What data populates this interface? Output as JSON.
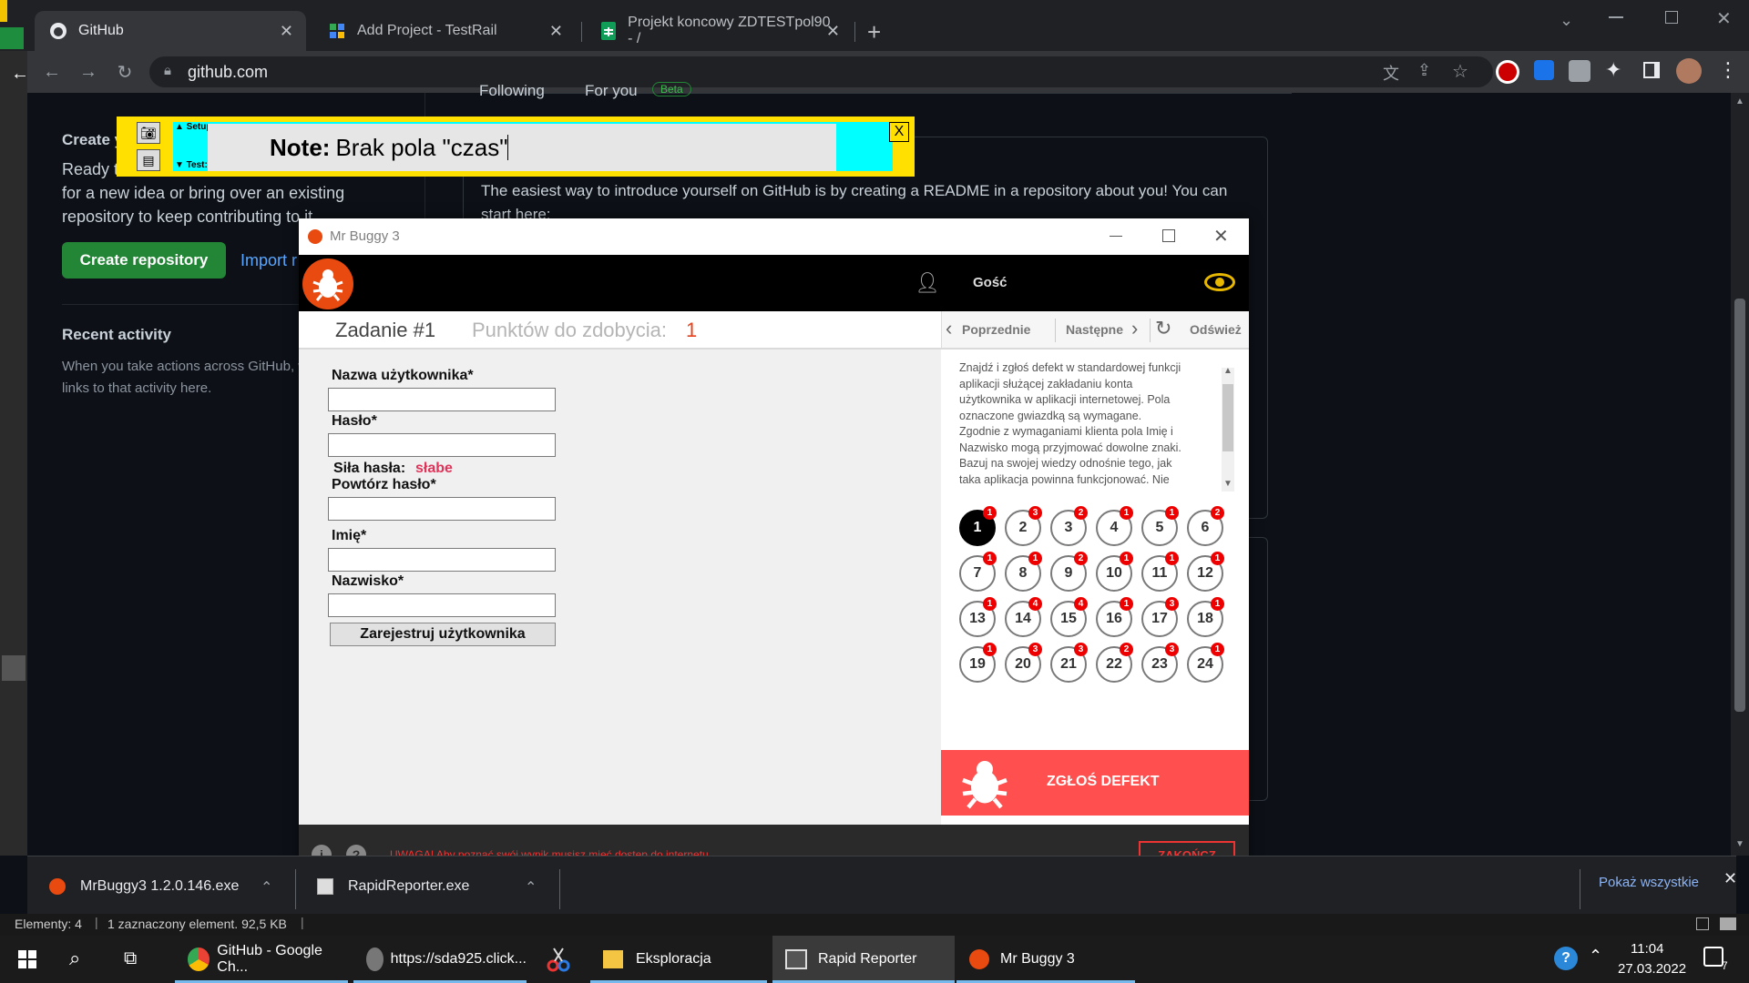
{
  "browser": {
    "tabs": [
      {
        "label": "GitHub"
      },
      {
        "label": "Add Project - TestRail"
      },
      {
        "label": "Projekt koncowy ZDTESTpol90 - /"
      }
    ],
    "url": "github.com"
  },
  "github": {
    "feed_tabs": [
      "Following",
      "For you",
      "Beta"
    ],
    "create_heading": "Create y",
    "create_text_1": "Ready t",
    "create_text_2": "for a new idea or bring over an existing",
    "create_text_3": "repository to keep contributing to it.",
    "create_button": "Create repository",
    "import_link": "Import r",
    "recent_heading": "Recent activity",
    "recent_text_1": "When you take actions across GitHub, w",
    "recent_text_2": "links to that activity here.",
    "readme_text_1": "The easiest way to introduce yourself on GitHub is by creating a README in a repository about you! You can",
    "readme_text_2": "start here:"
  },
  "rapid_reporter": {
    "setup_label": "▲ Setup:",
    "test_label": "▼ Test:",
    "note_label": "Note:",
    "note_text": "Brak pola \"czas\"",
    "close_label": "X"
  },
  "mrbuggy": {
    "window_title": "Mr Buggy 3",
    "user_label": "Gość",
    "task_title": "Zadanie #1",
    "points_label": "Punktów do zdobycia:",
    "points_value": "1",
    "nav_prev": "Poprzednie",
    "nav_next": "Następne",
    "nav_refresh": "Odśwież",
    "form": {
      "username_label": "Nazwa użytkownika*",
      "password_label": "Hasło*",
      "strength_label": "Siła hasła:",
      "strength_value": "słabe",
      "repeat_label": "Powtórz hasło*",
      "firstname_label": "Imię*",
      "lastname_label": "Nazwisko*",
      "submit_label": "Zarejestruj użytkownika"
    },
    "description_lines": [
      "Znajdź i zgłoś defekt w standardowej funkcji",
      "aplikacji służącej zakładaniu konta",
      "użytkownika w aplikacji internetowej. Pola",
      "oznaczone gwiazdką są wymagane.",
      "Zgodnie z wymaganiami klienta pola Imię i",
      "Nazwisko mogą przyjmować dowolne znaki.",
      "Bazuj na swojej wiedzy odnośnie tego, jak",
      "taka aplikacja powinna funkcjonować. Nie"
    ],
    "tasks": [
      {
        "n": "1",
        "badge": "1"
      },
      {
        "n": "2",
        "badge": "3"
      },
      {
        "n": "3",
        "badge": "2"
      },
      {
        "n": "4",
        "badge": "1"
      },
      {
        "n": "5",
        "badge": "1"
      },
      {
        "n": "6",
        "badge": "2"
      },
      {
        "n": "7",
        "badge": "1"
      },
      {
        "n": "8",
        "badge": "1"
      },
      {
        "n": "9",
        "badge": "2"
      },
      {
        "n": "10",
        "badge": "1"
      },
      {
        "n": "11",
        "badge": "1"
      },
      {
        "n": "12",
        "badge": "1"
      },
      {
        "n": "13",
        "badge": "1"
      },
      {
        "n": "14",
        "badge": "4"
      },
      {
        "n": "15",
        "badge": "4"
      },
      {
        "n": "16",
        "badge": "1"
      },
      {
        "n": "17",
        "badge": "3"
      },
      {
        "n": "18",
        "badge": "1"
      },
      {
        "n": "19",
        "badge": "1"
      },
      {
        "n": "20",
        "badge": "3"
      },
      {
        "n": "21",
        "badge": "3"
      },
      {
        "n": "22",
        "badge": "2"
      },
      {
        "n": "23",
        "badge": "3"
      },
      {
        "n": "24",
        "badge": "1"
      }
    ],
    "report_button": "ZGŁOŚ DEFEKT",
    "warning": "UWAGA! Aby poznać swój wynik musisz mieć dostęp do internetu.",
    "finish_button": "ZAKOŃCZ"
  },
  "downloads": {
    "items": [
      {
        "label": "MrBuggy3 1.2.0.146.exe"
      },
      {
        "label": "RapidReporter.exe"
      }
    ],
    "show_all": "Pokaż wszystkie"
  },
  "explorer_status": {
    "elements": "Elementy: 4",
    "selected": "1 zaznaczony element. 92,5 KB"
  },
  "taskbar": {
    "apps": [
      {
        "label": "GitHub - Google Ch..."
      },
      {
        "label": "https://sda925.click..."
      },
      {
        "label": "Eksploracja"
      },
      {
        "label": "Rapid Reporter"
      },
      {
        "label": "Mr Buggy 3"
      }
    ],
    "time": "11:04",
    "date": "27.03.2022",
    "notifications": "7"
  }
}
